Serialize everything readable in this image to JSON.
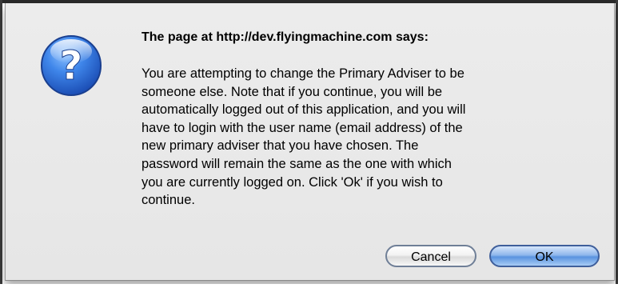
{
  "dialog": {
    "heading": "The page at http://dev.flyingmachine.com says:",
    "icon": "question-mark-icon",
    "message_lines": [
      "You are attempting to change the Primary Adviser to be",
      "someone else.  Note that if you continue, you will be",
      "automatically logged out of this application, and you will",
      "have to login with the user name (email address) of the",
      "new primary adviser that you have chosen.  The",
      "password will remain the same as the one with which",
      "you are currently logged on.  Click 'Ok' if you wish to",
      "continue."
    ],
    "buttons": {
      "cancel": "Cancel",
      "ok": "OK"
    }
  },
  "colors": {
    "icon_blue": "#2f6fd8",
    "ok_button": "#5a93e0",
    "dialog_background": "#e8e8e8"
  }
}
